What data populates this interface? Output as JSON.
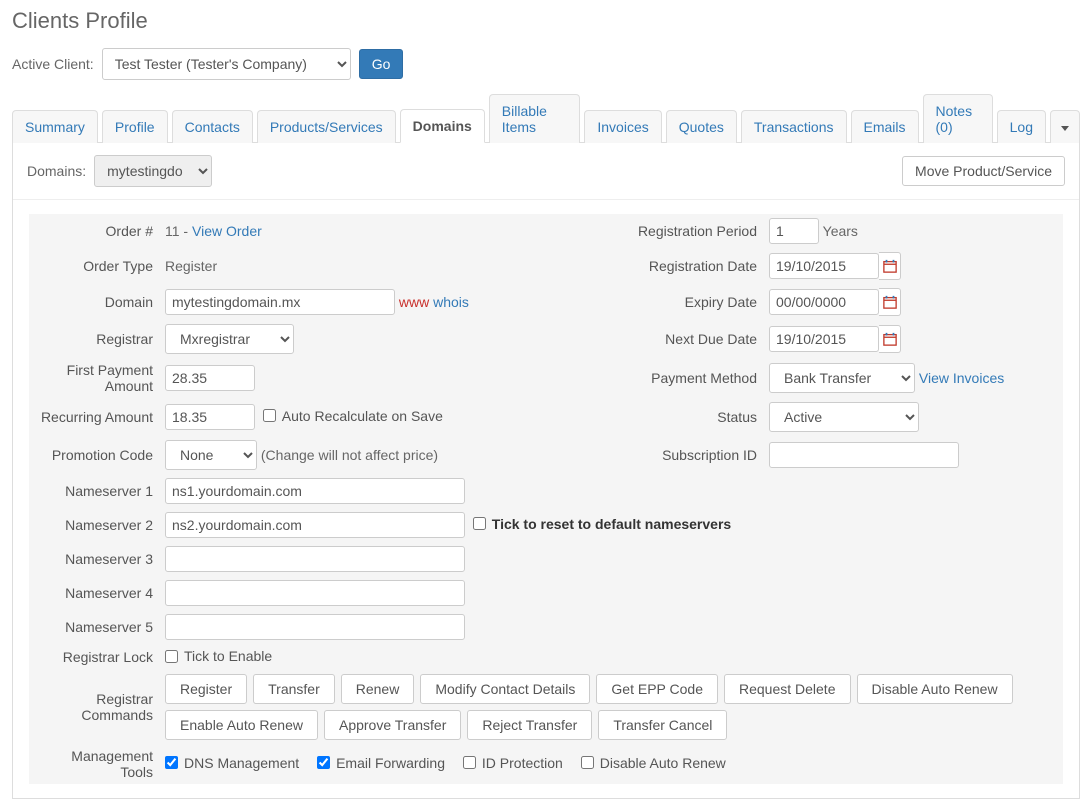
{
  "page": {
    "title": "Clients Profile"
  },
  "activeClient": {
    "label": "Active Client:",
    "selected": "Test Tester (Tester's Company)",
    "goLabel": "Go"
  },
  "tabs": [
    "Summary",
    "Profile",
    "Contacts",
    "Products/Services",
    "Domains",
    "Billable Items",
    "Invoices",
    "Quotes",
    "Transactions",
    "Emails",
    "Notes (0)",
    "Log"
  ],
  "activeTab": "Domains",
  "domainsBar": {
    "label": "Domains:",
    "selected": "mytestingdo",
    "moveLabel": "Move Product/Service"
  },
  "form": {
    "orderNumLabel": "Order #",
    "orderNum": "11",
    "viewOrder": "View Order",
    "regPeriodLabel": "Registration Period",
    "regPeriodValue": "1",
    "regPeriodUnit": "Years",
    "orderTypeLabel": "Order Type",
    "orderType": "Register",
    "regDateLabel": "Registration Date",
    "regDate": "19/10/2015",
    "domainLabel": "Domain",
    "domain": "mytestingdomain.mx",
    "wwwLink": "www",
    "whoisLink": "whois",
    "expiryLabel": "Expiry Date",
    "expiry": "00/00/0000",
    "registrarLabel": "Registrar",
    "registrar": "Mxregistrar",
    "nextDueLabel": "Next Due Date",
    "nextDue": "19/10/2015",
    "firstPaymentLabel": "First Payment Amount",
    "firstPayment": "28.35",
    "paymentMethodLabel": "Payment Method",
    "paymentMethod": "Bank Transfer",
    "viewInvoices": "View Invoices",
    "recurringLabel": "Recurring Amount",
    "recurring": "18.35",
    "autoRecalcLabel": "Auto Recalculate on Save",
    "statusLabel": "Status",
    "status": "Active",
    "promoLabel": "Promotion Code",
    "promo": "None",
    "promoNote": "(Change will not affect price)",
    "subIdLabel": "Subscription ID",
    "subId": "",
    "ns1Label": "Nameserver 1",
    "ns1": "ns1.yourdomain.com",
    "ns2Label": "Nameserver 2",
    "ns2": "ns2.yourdomain.com",
    "nsResetLabel": "Tick to reset to default nameservers",
    "ns3Label": "Nameserver 3",
    "ns3": "",
    "ns4Label": "Nameserver 4",
    "ns4": "",
    "ns5Label": "Nameserver 5",
    "ns5": "",
    "regLockLabel": "Registrar Lock",
    "tickEnable": "Tick to Enable",
    "regCommandsLabel": "Registrar Commands",
    "commands1": [
      "Register",
      "Transfer",
      "Renew",
      "Modify Contact Details",
      "Get EPP Code",
      "Request Delete",
      "Disable Auto Renew"
    ],
    "commands2": [
      "Enable Auto Renew",
      "Approve Transfer",
      "Reject Transfer",
      "Transfer Cancel"
    ],
    "mgmtLabel": "Management Tools",
    "dnsMgmt": "DNS Management",
    "emailFwd": "Email Forwarding",
    "idProt": "ID Protection",
    "disableAuto": "Disable Auto Renew"
  }
}
